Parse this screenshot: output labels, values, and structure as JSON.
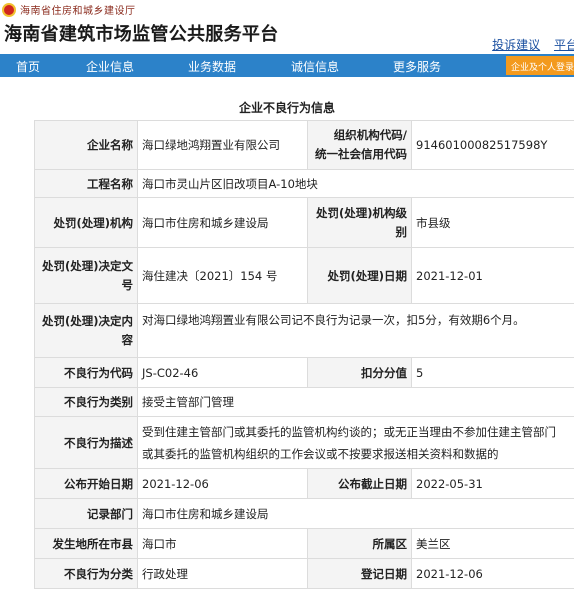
{
  "header": {
    "dept": "海南省住房和城乡建设厅",
    "title": "海南省建筑市场监管公共服务平台",
    "links": [
      "投诉建议",
      "平台"
    ]
  },
  "nav": {
    "items": [
      "首页",
      "企业信息",
      "业务数据",
      "诚信信息",
      "更多服务"
    ],
    "button": "企业及个人登录"
  },
  "section_title": "企业不良行为信息",
  "fields": {
    "company_name": {
      "label": "企业名称",
      "value": "海口绿地鸿翔置业有限公司"
    },
    "org_code": {
      "label1": "组织机构代码/",
      "label2": "统一社会信用代码",
      "value": "91460100082517598Y"
    },
    "project_name": {
      "label": "工程名称",
      "value": "海口市灵山片区旧改项目A-10地块"
    },
    "penalty_org": {
      "label": "处罚(处理)机构",
      "value": "海口市住房和城乡建设局"
    },
    "penalty_level": {
      "label1": "处罚(处理)机构级",
      "label2": "别",
      "value": "市县级"
    },
    "decision_doc": {
      "label1": "处罚(处理)决定文",
      "label2": "号",
      "value": "海住建决〔2021〕154 号"
    },
    "penalty_date": {
      "label": "处罚(处理)日期",
      "value": "2021-12-01"
    },
    "decision_content": {
      "label1": "处罚(处理)决定内",
      "label2": "容",
      "value": "对海口绿地鸿翔置业有限公司记不良行为记录一次，扣5分，有效期6个月。"
    },
    "behavior_code": {
      "label": "不良行为代码",
      "value": "JS-C02-46"
    },
    "deduct_score": {
      "label": "扣分分值",
      "value": "5"
    },
    "behavior_category": {
      "label": "不良行为类别",
      "value": "接受主管部门管理"
    },
    "behavior_desc": {
      "label": "不良行为描述",
      "line1": "受到住建主管部门或其委托的监管机构约谈的；或无正当理由不参加住建主管部门",
      "line2": "或其委托的监管机构组织的工作会议或不按要求报送相关资料和数据的"
    },
    "publish_start": {
      "label": "公布开始日期",
      "value": "2021-12-06"
    },
    "publish_end": {
      "label": "公布截止日期",
      "value": "2022-05-31"
    },
    "record_dept": {
      "label": "记录部门",
      "value": "海口市住房和城乡建设局"
    },
    "location_city": {
      "label": "发生地所在市县",
      "value": "海口市"
    },
    "district": {
      "label": "所属区",
      "value": "美兰区"
    },
    "behavior_class": {
      "label": "不良行为分类",
      "value": "行政处理"
    },
    "register_date": {
      "label": "登记日期",
      "value": "2021-12-06"
    }
  }
}
